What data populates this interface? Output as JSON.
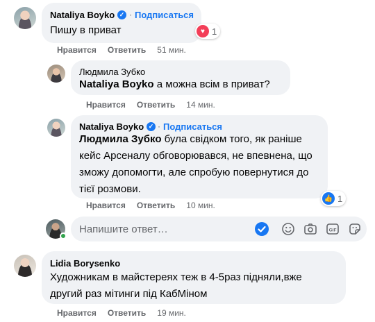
{
  "comments": [
    {
      "author": "Nataliya Boyko",
      "follow_label": "Подписаться",
      "separator": "·",
      "text": "Пишу в приват",
      "reaction_count": "1",
      "like_label": "Нравится",
      "reply_label": "Ответить",
      "time": "51 мин."
    },
    {
      "author": "Людмила Зубко",
      "mention": "Nataliya Boyko",
      "text": " а можна всім в приват?",
      "like_label": "Нравится",
      "reply_label": "Ответить",
      "time": "14 мин."
    },
    {
      "author": "Nataliya Boyko",
      "follow_label": "Подписаться",
      "separator": "·",
      "mention": "Людмила Зубко",
      "text_line1_rest": " була свідком того, як раніше",
      "text_line2": "кейс Арсеналу обговорювався, не впевнена, що",
      "text_line3": "зможу допомогти, але спробую повернутися до",
      "text_line4": "тієї розмови.",
      "reaction_count": "1",
      "like_label": "Нравится",
      "reply_label": "Ответить",
      "time": "10 мин."
    },
    {
      "author": "Lidia Borysenko",
      "text_line1": "Художникам в майстереях теж в 4-5раз підняли,вже",
      "text_line2": "другий раз мітинги під КабМіном",
      "like_label": "Нравится",
      "reply_label": "Ответить",
      "time": "19 мин."
    }
  ],
  "reply_box": {
    "placeholder": "Напишите ответ…"
  },
  "reply_tools": [
    "checkmark-icon",
    "emoji-icon",
    "camera-icon",
    "gif-icon",
    "sticker-icon"
  ],
  "colors": {
    "accent": "#1877f2",
    "bubble": "#f0f2f5",
    "meta_text": "#65676b",
    "love": "#f33e58",
    "online": "#31a24c"
  }
}
